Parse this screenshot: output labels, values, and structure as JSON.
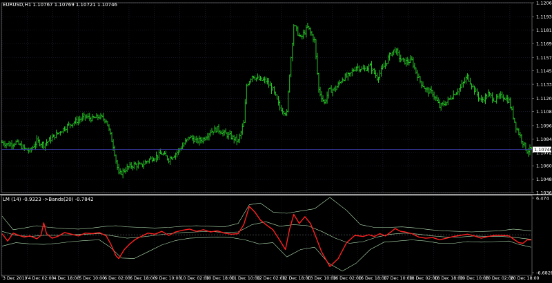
{
  "window": {
    "title": "EURUSD,H1  1.10767 1.10769 1.10721 1.10746"
  },
  "indicator": {
    "title": "LM (14) -0.9323  ->Bands(20) -0.7842"
  },
  "colors": {
    "background": "#000000",
    "grid": "#2f2f4f",
    "candle": "#2bd62b",
    "price_line": "#3a3aa0",
    "indicator_line": "#ff2020",
    "bands": "#b7e6b7",
    "axis_text": "#ffffff"
  },
  "chart_data": [
    {
      "type": "candlestick",
      "symbol": "EURUSD",
      "timeframe": "H1",
      "current_price": "1.10746",
      "ylim": [
        1.1036,
        1.1206
      ],
      "y_ticks": [
        "1.12060",
        "1.11935",
        "1.11815",
        "1.11695",
        "1.11570",
        "1.11450",
        "1.11330",
        "1.11205",
        "1.11085",
        "1.10960",
        "1.10840",
        "1.10720",
        "1.10600",
        "1.10480",
        "1.10360"
      ],
      "x_ticks": [
        "3 Dec 2019",
        "4 Dec 02:00",
        "4 Dec 18:00",
        "5 Dec 10:00",
        "6 Dec 02:00",
        "6 Dec 18:00",
        "9 Dec 10:00",
        "10 Dec 02:00",
        "10 Dec 18:00",
        "11 Dec 10:00",
        "12 Dec 02:00",
        "12 Dec 18:00",
        "13 Dec 10:00",
        "16 Dec 02:00",
        "16 Dec 18:00",
        "17 Dec 10:00",
        "18 Dec 02:00",
        "18 Dec 18:00",
        "19 Dec 10:00",
        "20 Dec 02:00",
        "20 Dec 18:00"
      ],
      "anchors": [
        [
          0,
          1.1081
        ],
        [
          5,
          1.1079
        ],
        [
          10,
          1.1081
        ],
        [
          15,
          1.1076
        ],
        [
          20,
          1.1073
        ],
        [
          25,
          1.1082
        ],
        [
          30,
          1.1079
        ],
        [
          35,
          1.1084
        ],
        [
          40,
          1.1089
        ],
        [
          45,
          1.1094
        ],
        [
          50,
          1.1098
        ],
        [
          55,
          1.1101
        ],
        [
          60,
          1.1104
        ],
        [
          65,
          1.1102
        ],
        [
          70,
          1.1104
        ],
        [
          75,
          1.1101
        ],
        [
          80,
          1.1078
        ],
        [
          84,
          1.1052
        ],
        [
          90,
          1.1058
        ],
        [
          95,
          1.1061
        ],
        [
          100,
          1.106
        ],
        [
          105,
          1.1065
        ],
        [
          110,
          1.1068
        ],
        [
          115,
          1.1071
        ],
        [
          120,
          1.1066
        ],
        [
          125,
          1.1071
        ],
        [
          130,
          1.1078
        ],
        [
          135,
          1.1086
        ],
        [
          140,
          1.1082
        ],
        [
          145,
          1.1084
        ],
        [
          150,
          1.1091
        ],
        [
          155,
          1.1093
        ],
        [
          160,
          1.1089
        ],
        [
          165,
          1.1086
        ],
        [
          170,
          1.1082
        ],
        [
          174,
          1.1098
        ],
        [
          176,
          1.1132
        ],
        [
          180,
          1.1141
        ],
        [
          185,
          1.1137
        ],
        [
          190,
          1.1136
        ],
        [
          195,
          1.1128
        ],
        [
          200,
          1.1112
        ],
        [
          205,
          1.1107
        ],
        [
          207,
          1.1143
        ],
        [
          210,
          1.1186
        ],
        [
          215,
          1.1174
        ],
        [
          220,
          1.1184
        ],
        [
          225,
          1.1172
        ],
        [
          228,
          1.1128
        ],
        [
          232,
          1.1116
        ],
        [
          235,
          1.1127
        ],
        [
          240,
          1.1129
        ],
        [
          245,
          1.1138
        ],
        [
          250,
          1.1141
        ],
        [
          255,
          1.1149
        ],
        [
          260,
          1.1146
        ],
        [
          265,
          1.1149
        ],
        [
          270,
          1.1139
        ],
        [
          275,
          1.1149
        ],
        [
          280,
          1.1161
        ],
        [
          283,
          1.1164
        ],
        [
          287,
          1.1155
        ],
        [
          290,
          1.1153
        ],
        [
          295,
          1.1154
        ],
        [
          300,
          1.1138
        ],
        [
          305,
          1.1128
        ],
        [
          310,
          1.1125
        ],
        [
          315,
          1.1113
        ],
        [
          320,
          1.1117
        ],
        [
          325,
          1.1124
        ],
        [
          330,
          1.113
        ],
        [
          335,
          1.114
        ],
        [
          340,
          1.1128
        ],
        [
          345,
          1.1118
        ],
        [
          350,
          1.1124
        ],
        [
          355,
          1.1119
        ],
        [
          360,
          1.1123
        ],
        [
          365,
          1.1118
        ],
        [
          370,
          1.1095
        ],
        [
          375,
          1.1081
        ],
        [
          378,
          1.1073
        ],
        [
          381,
          1.1075
        ]
      ]
    },
    {
      "type": "line",
      "name": "LM (14)",
      "value": "-0.9323",
      "bands_value": "-0.7842",
      "ylim": [
        -6.6828,
        6.474
      ],
      "y_ticks": [
        "6.474",
        "-6.6828"
      ],
      "main": [
        [
          0,
          0.2
        ],
        [
          4,
          -1.1
        ],
        [
          8,
          0.3
        ],
        [
          12,
          -0.1
        ],
        [
          16,
          -0.4
        ],
        [
          20,
          -0.2
        ],
        [
          25,
          -0.7
        ],
        [
          28,
          -0.1
        ],
        [
          30,
          2.1
        ],
        [
          32,
          0.2
        ],
        [
          36,
          -0.6
        ],
        [
          40,
          -0.3
        ],
        [
          45,
          0.4
        ],
        [
          50,
          0.1
        ],
        [
          55,
          -0.2
        ],
        [
          60,
          0.3
        ],
        [
          65,
          0.2
        ],
        [
          70,
          0.4
        ],
        [
          75,
          -0.2
        ],
        [
          78,
          -1.5
        ],
        [
          82,
          -3.7
        ],
        [
          84,
          -4.2
        ],
        [
          88,
          -2.6
        ],
        [
          92,
          -1.6
        ],
        [
          96,
          -0.8
        ],
        [
          100,
          -0.3
        ],
        [
          105,
          0.3
        ],
        [
          110,
          0.1
        ],
        [
          115,
          0.6
        ],
        [
          120,
          -0.1
        ],
        [
          125,
          0.5
        ],
        [
          130,
          0.8
        ],
        [
          135,
          1.0
        ],
        [
          140,
          0.6
        ],
        [
          145,
          0.9
        ],
        [
          150,
          0.5
        ],
        [
          155,
          0.7
        ],
        [
          160,
          0.3
        ],
        [
          165,
          0.1
        ],
        [
          170,
          0.2
        ],
        [
          174,
          1.8
        ],
        [
          178,
          5.0
        ],
        [
          182,
          4.0
        ],
        [
          186,
          2.6
        ],
        [
          190,
          1.8
        ],
        [
          195,
          0.9
        ],
        [
          200,
          -1.0
        ],
        [
          204,
          -2.6
        ],
        [
          207,
          1.0
        ],
        [
          210,
          3.6
        ],
        [
          214,
          2.0
        ],
        [
          218,
          3.2
        ],
        [
          222,
          2.0
        ],
        [
          225,
          0.2
        ],
        [
          230,
          -3.0
        ],
        [
          236,
          -5.6
        ],
        [
          242,
          -4.2
        ],
        [
          248,
          -1.4
        ],
        [
          254,
          -0.1
        ],
        [
          260,
          -0.3
        ],
        [
          264,
          0.0
        ],
        [
          268,
          -0.3
        ],
        [
          272,
          0.2
        ],
        [
          276,
          -0.2
        ],
        [
          280,
          0.5
        ],
        [
          283,
          1.1
        ],
        [
          287,
          0.6
        ],
        [
          290,
          0.5
        ],
        [
          295,
          0.2
        ],
        [
          300,
          -0.4
        ],
        [
          305,
          -0.6
        ],
        [
          310,
          -0.5
        ],
        [
          315,
          -0.9
        ],
        [
          320,
          -0.6
        ],
        [
          325,
          -0.3
        ],
        [
          330,
          -0.1
        ],
        [
          335,
          0.1
        ],
        [
          340,
          -0.2
        ],
        [
          345,
          -0.6
        ],
        [
          350,
          -0.3
        ],
        [
          355,
          -0.1
        ],
        [
          360,
          -0.1
        ],
        [
          365,
          -0.2
        ],
        [
          369,
          -0.9
        ],
        [
          372,
          -1.4
        ],
        [
          375,
          -1.5
        ],
        [
          378,
          -0.9
        ],
        [
          381,
          -0.9
        ]
      ],
      "upper_band": [
        [
          0,
          3.3
        ],
        [
          8,
          0.9
        ],
        [
          16,
          1.2
        ],
        [
          25,
          1.6
        ],
        [
          34,
          1.3
        ],
        [
          45,
          1.1
        ],
        [
          55,
          1.0
        ],
        [
          65,
          1.2
        ],
        [
          75,
          1.5
        ],
        [
          82,
          1.6
        ],
        [
          90,
          1.4
        ],
        [
          100,
          1.3
        ],
        [
          110,
          1.2
        ],
        [
          120,
          1.3
        ],
        [
          130,
          1.5
        ],
        [
          140,
          1.6
        ],
        [
          150,
          1.5
        ],
        [
          160,
          1.4
        ],
        [
          170,
          2.0
        ],
        [
          178,
          5.3
        ],
        [
          186,
          5.6
        ],
        [
          195,
          4.0
        ],
        [
          205,
          3.8
        ],
        [
          215,
          4.2
        ],
        [
          225,
          4.6
        ],
        [
          236,
          6.6
        ],
        [
          248,
          4.3
        ],
        [
          258,
          1.8
        ],
        [
          268,
          1.3
        ],
        [
          278,
          1.3
        ],
        [
          288,
          1.4
        ],
        [
          298,
          1.2
        ],
        [
          308,
          0.9
        ],
        [
          318,
          0.7
        ],
        [
          328,
          0.6
        ],
        [
          338,
          0.5
        ],
        [
          348,
          0.6
        ],
        [
          358,
          0.7
        ],
        [
          368,
          1.0
        ],
        [
          381,
          0.7
        ]
      ],
      "middle_band": [
        [
          0,
          0.6
        ],
        [
          10,
          -0.1
        ],
        [
          20,
          -0.3
        ],
        [
          30,
          -0.1
        ],
        [
          40,
          -0.1
        ],
        [
          50,
          0.0
        ],
        [
          60,
          0.1
        ],
        [
          70,
          0.2
        ],
        [
          80,
          -0.2
        ],
        [
          90,
          -0.6
        ],
        [
          100,
          -0.4
        ],
        [
          110,
          -0.1
        ],
        [
          120,
          0.2
        ],
        [
          130,
          0.4
        ],
        [
          140,
          0.5
        ],
        [
          150,
          0.6
        ],
        [
          160,
          0.4
        ],
        [
          170,
          0.5
        ],
        [
          180,
          1.8
        ],
        [
          190,
          2.3
        ],
        [
          200,
          1.5
        ],
        [
          210,
          1.8
        ],
        [
          220,
          1.6
        ],
        [
          230,
          0.6
        ],
        [
          240,
          -0.6
        ],
        [
          250,
          -1.5
        ],
        [
          260,
          -1.2
        ],
        [
          270,
          -0.4
        ],
        [
          280,
          0.1
        ],
        [
          290,
          0.3
        ],
        [
          300,
          0.1
        ],
        [
          310,
          -0.2
        ],
        [
          320,
          -0.4
        ],
        [
          330,
          -0.4
        ],
        [
          340,
          -0.2
        ],
        [
          350,
          -0.3
        ],
        [
          360,
          -0.3
        ],
        [
          370,
          -0.5
        ],
        [
          381,
          -0.8
        ]
      ],
      "lower_band": [
        [
          0,
          -2.0
        ],
        [
          10,
          -1.4
        ],
        [
          20,
          -1.6
        ],
        [
          30,
          -1.7
        ],
        [
          40,
          -1.5
        ],
        [
          50,
          -1.2
        ],
        [
          60,
          -1.0
        ],
        [
          70,
          -0.9
        ],
        [
          78,
          -2.2
        ],
        [
          86,
          -4.1
        ],
        [
          95,
          -4.2
        ],
        [
          105,
          -3.0
        ],
        [
          115,
          -1.8
        ],
        [
          125,
          -1.0
        ],
        [
          135,
          -0.6
        ],
        [
          145,
          -0.5
        ],
        [
          155,
          -0.4
        ],
        [
          165,
          -0.5
        ],
        [
          175,
          -0.9
        ],
        [
          185,
          -1.6
        ],
        [
          195,
          -1.4
        ],
        [
          205,
          -3.9
        ],
        [
          215,
          -2.6
        ],
        [
          225,
          -2.2
        ],
        [
          235,
          -5.0
        ],
        [
          245,
          -6.4
        ],
        [
          255,
          -5.0
        ],
        [
          265,
          -2.6
        ],
        [
          275,
          -1.3
        ],
        [
          285,
          -1.1
        ],
        [
          295,
          -0.9
        ],
        [
          305,
          -1.1
        ],
        [
          315,
          -1.5
        ],
        [
          325,
          -1.5
        ],
        [
          335,
          -1.2
        ],
        [
          345,
          -1.3
        ],
        [
          355,
          -1.2
        ],
        [
          365,
          -1.1
        ],
        [
          372,
          -1.7
        ],
        [
          381,
          -2.2
        ]
      ]
    }
  ]
}
